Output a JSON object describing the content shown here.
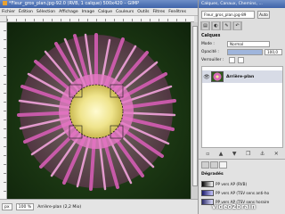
{
  "main_window": {
    "title": "*Fleur_gros_plan.jpg-92.0 (RVB, 1 calque) 500x420 – GIMP"
  },
  "menubar": [
    "Fichier",
    "Édition",
    "Sélection",
    "Affichage",
    "Image",
    "Calque",
    "Couleurs",
    "Outils",
    "Filtres",
    "Fenêtres"
  ],
  "statusbar": {
    "unit": "px",
    "zoom": "100 %",
    "layer_info": "Arrière-plan (2,2 Mio)"
  },
  "dock": {
    "title": "Calques, Canaux, Chemins, ...",
    "image_selector": "Fleur_gros_plan.jpg-89",
    "auto_label": "Auto",
    "panel_title": "Calques",
    "mode_label": "Mode :",
    "mode_value": "Normal",
    "opacity_label": "Opacité :",
    "opacity_value": "100,0",
    "lock_label": "Verrouiller :",
    "layers": [
      {
        "name": "Arrière-plan",
        "visible": true
      }
    ]
  },
  "gradients": {
    "title": "Dégradés",
    "items": [
      {
        "name": "PP vers AP (RVB)",
        "colors": [
          "#000000",
          "#ffffff"
        ]
      },
      {
        "name": "PP vers AP (TSV sens anti-ho",
        "colors": [
          "#1a1a6a",
          "#c8c8ff"
        ]
      },
      {
        "name": "PP vers AP (TSV sens horaire",
        "colors": [
          "#2a2a6a",
          "#e0e0ff"
        ]
      }
    ]
  },
  "watermark": "video2brain",
  "colors": {
    "title_blue": "#3e63a8",
    "petal_pink": "#d86ab8",
    "center_yellow": "#f1e79a"
  }
}
